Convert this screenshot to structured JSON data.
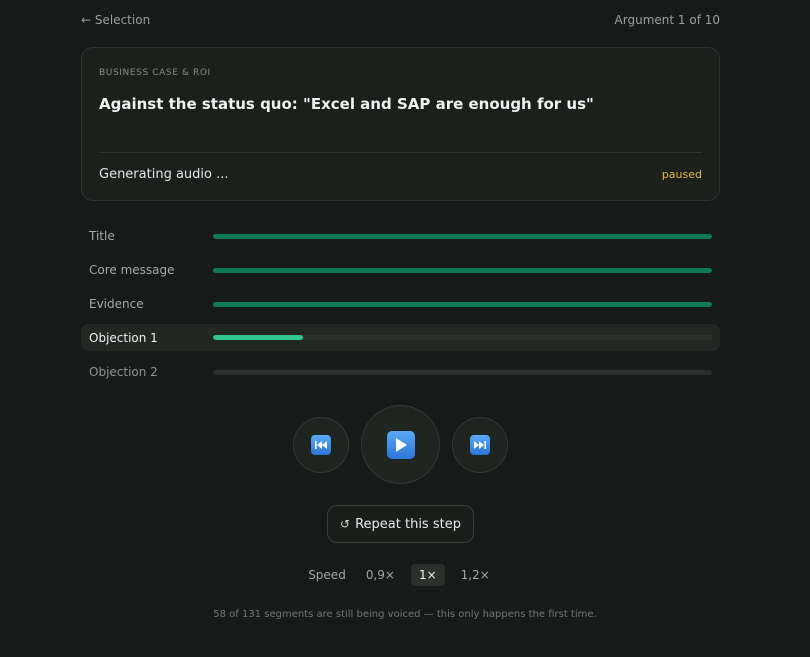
{
  "topbar": {
    "back_label": "← Selection",
    "counter": "Argument 1 of 10"
  },
  "card": {
    "category": "BUSINESS CASE & ROI",
    "title": "Against the status quo: \"Excel and SAP are enough for us\"",
    "status": "Generating audio ...",
    "badge": "paused"
  },
  "steps": [
    {
      "label": "Title",
      "progress": 1.0,
      "state": "done"
    },
    {
      "label": "Core message",
      "progress": 1.0,
      "state": "done"
    },
    {
      "label": "Evidence",
      "progress": 1.0,
      "state": "done"
    },
    {
      "label": "Objection 1",
      "progress": 0.18,
      "state": "active"
    },
    {
      "label": "Objection 2",
      "progress": 0.0,
      "state": "pending"
    }
  ],
  "controls": {
    "prev_icon": "rewind-icon",
    "play_icon": "play-icon",
    "next_icon": "fast-forward-icon"
  },
  "repeat": {
    "icon": "↺",
    "label": "Repeat this step"
  },
  "speed": {
    "label": "Speed",
    "options": [
      "0,9×",
      "1×",
      "1,2×"
    ],
    "selected": "1×"
  },
  "footnote": "58 of 131 segments are still being voiced — this only happens the first time.",
  "colors": {
    "accent": "#2fc58c",
    "done": "#0f7a56",
    "paused": "#e6b84a"
  }
}
